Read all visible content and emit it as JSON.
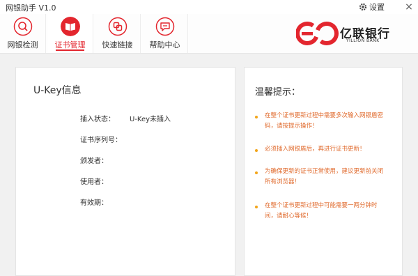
{
  "window": {
    "title": "网银助手 V1.0",
    "settings_label": "设置",
    "close_glyph": "×"
  },
  "tabs": [
    {
      "label": "网银检测",
      "icon": "search-icon"
    },
    {
      "label": "证书管理",
      "icon": "book-icon"
    },
    {
      "label": "快速链接",
      "icon": "link-icon"
    },
    {
      "label": "帮助中心",
      "icon": "chat-icon"
    }
  ],
  "brand": {
    "name": "亿联银行",
    "name_en": "YILLION BANK",
    "color": "#e3262e"
  },
  "ukey": {
    "title": "U-Key信息",
    "rows": [
      {
        "label": "插入状态：",
        "value": "U-Key未插入"
      },
      {
        "label": "证书序列号：",
        "value": ""
      },
      {
        "label": "颁发者：",
        "value": ""
      },
      {
        "label": "使用者：",
        "value": ""
      },
      {
        "label": "有效期：",
        "value": ""
      }
    ]
  },
  "tips": {
    "title": "温馨提示：",
    "items": [
      {
        "line1": "在整个证书更新过程中需要多次输入网银盾密",
        "line2": "码，请按提示操作！"
      },
      {
        "line1": "必须插入网银盾后，再进行证书更新！",
        "line2": ""
      },
      {
        "line1": "为确保更新的证书正常使用，建议更新前关闭",
        "line2": "所有浏览器！"
      },
      {
        "line1": "在整个证书更新过程中可能需要一两分钟时",
        "line2": "间，请耐心等候！"
      }
    ]
  }
}
